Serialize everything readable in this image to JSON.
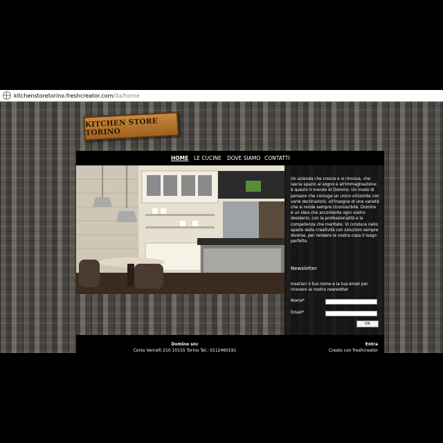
{
  "browser": {
    "url_host": "kitchenstoretorino.freshcreator.com",
    "url_path": "/ita/home"
  },
  "logo": {
    "text": "KITCHEN STORE TORINO"
  },
  "nav": {
    "items": [
      {
        "label": "HOME",
        "active": true
      },
      {
        "label": "LE CUCINE",
        "active": false
      },
      {
        "label": "DOVE SIAMO",
        "active": false
      },
      {
        "label": "CONTATTI",
        "active": false
      }
    ]
  },
  "intro": {
    "text": "Un azienda che cresce e si rinnova, che lascia spazio al sogno e all'immaginazione: è questo il mondo di Domino. Un modo di pensare che coniuga un unico orizzonte con varie declinazioni, all'insegna di una varietà che si rende sempre riconoscibile. Domino è un idea che accontenta ogni vostro desiderio, con la professionalità e la competenza che meritate. Vi conduce nello spazio della creatività con soluzioni sempre diverse, per rendere la vostra casa il luogo perfetto."
  },
  "newsletter": {
    "title": "Newsletter",
    "description": "Inserisci il tuo nome e la tua email per ricevere la nostra newsletter",
    "name_label": "Nome*",
    "email_label": "Email*",
    "name_value": "",
    "email_value": "",
    "submit_label": "OK"
  },
  "footer": {
    "company": "Domino snc",
    "address": "Corso Vercelli 210 10155 Torino Tel.: 0112460191",
    "login": "Entra",
    "credit": "Creato con freshcreator"
  },
  "colors": {
    "page_background": "#000000",
    "wood": "#5a5752",
    "logo_plank": "#c78a3d",
    "panel": "#0c0c0c",
    "text": "#ffffff"
  }
}
